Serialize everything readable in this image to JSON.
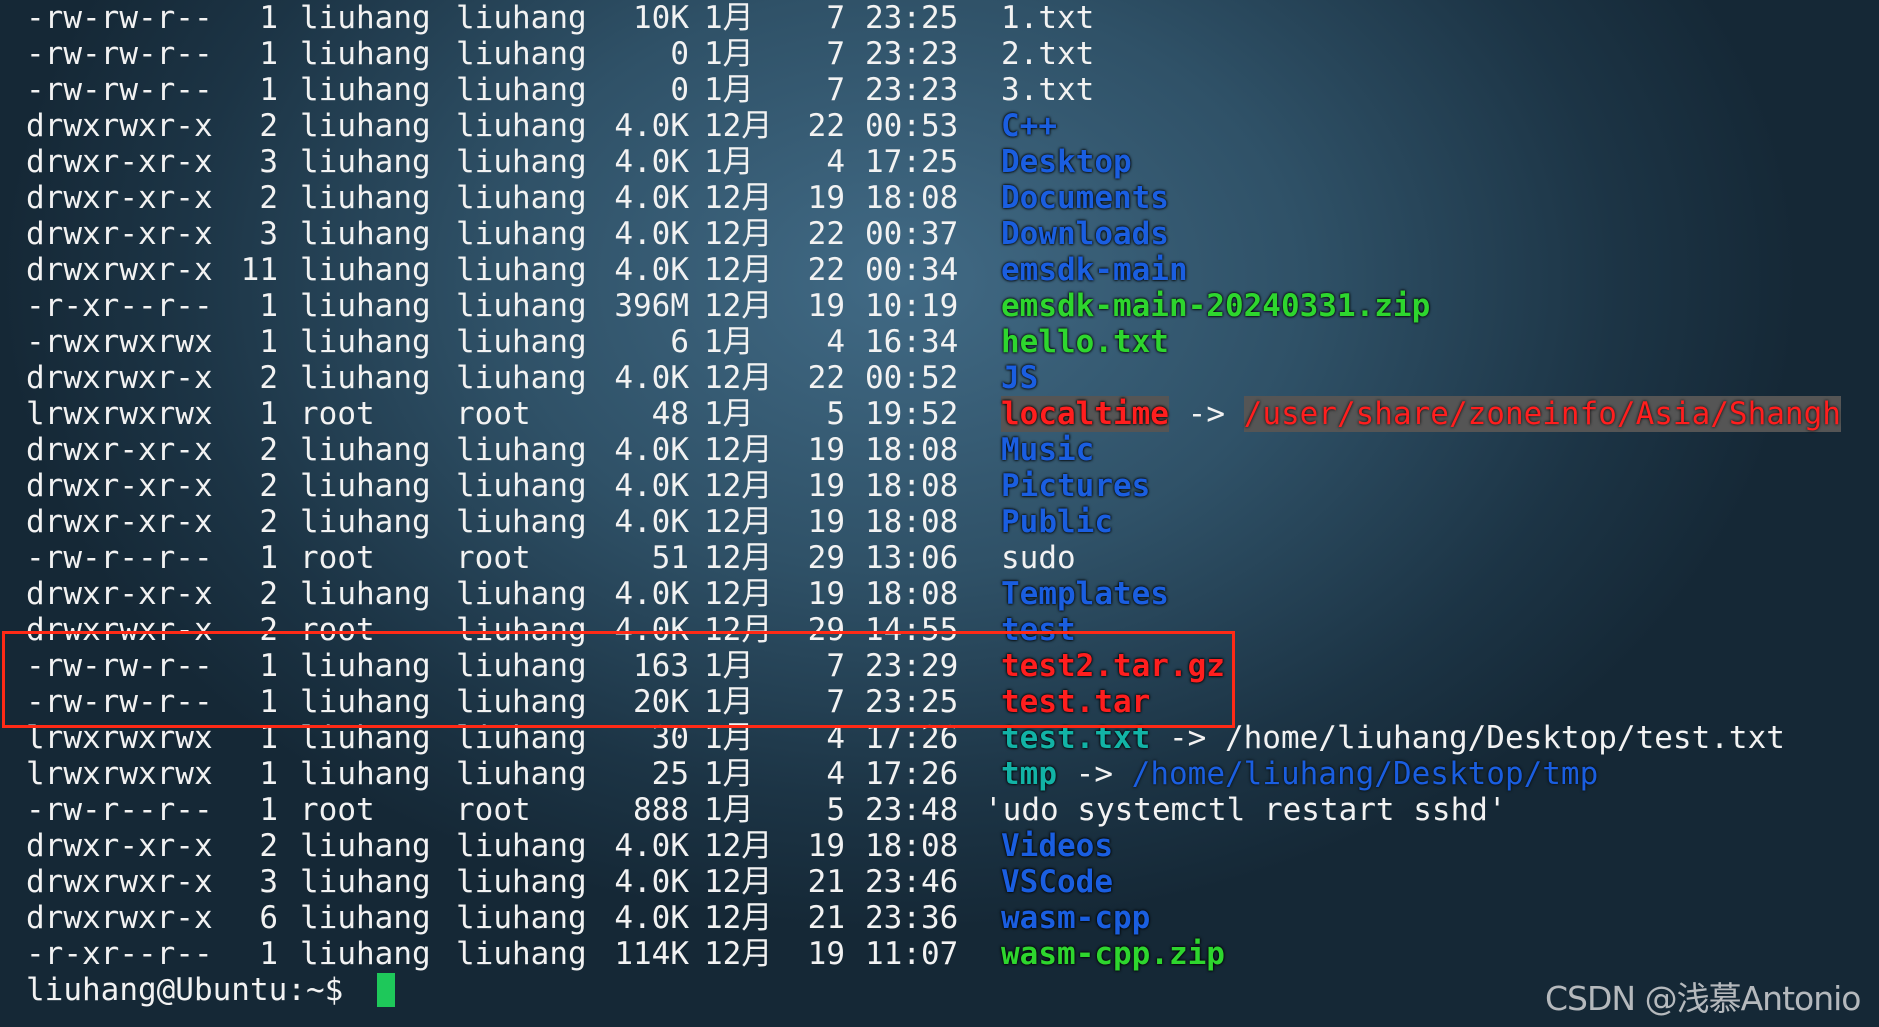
{
  "rows": [
    {
      "perm": "-rw-rw-r--",
      "links": "1",
      "owner": "liuhang",
      "group": "liuhang",
      "size": "10K",
      "month": "1月",
      "day": "7",
      "time": "23:25",
      "name": "1.txt",
      "kind": "plain"
    },
    {
      "perm": "-rw-rw-r--",
      "links": "1",
      "owner": "liuhang",
      "group": "liuhang",
      "size": "0",
      "month": "1月",
      "day": "7",
      "time": "23:23",
      "name": "2.txt",
      "kind": "plain"
    },
    {
      "perm": "-rw-rw-r--",
      "links": "1",
      "owner": "liuhang",
      "group": "liuhang",
      "size": "0",
      "month": "1月",
      "day": "7",
      "time": "23:23",
      "name": "3.txt",
      "kind": "plain"
    },
    {
      "perm": "drwxrwxr-x",
      "links": "2",
      "owner": "liuhang",
      "group": "liuhang",
      "size": "4.0K",
      "month": "12月",
      "day": "22",
      "time": "00:53",
      "name": "C++",
      "kind": "dir"
    },
    {
      "perm": "drwxr-xr-x",
      "links": "3",
      "owner": "liuhang",
      "group": "liuhang",
      "size": "4.0K",
      "month": "1月",
      "day": "4",
      "time": "17:25",
      "name": "Desktop",
      "kind": "dir"
    },
    {
      "perm": "drwxr-xr-x",
      "links": "2",
      "owner": "liuhang",
      "group": "liuhang",
      "size": "4.0K",
      "month": "12月",
      "day": "19",
      "time": "18:08",
      "name": "Documents",
      "kind": "dir"
    },
    {
      "perm": "drwxr-xr-x",
      "links": "3",
      "owner": "liuhang",
      "group": "liuhang",
      "size": "4.0K",
      "month": "12月",
      "day": "22",
      "time": "00:37",
      "name": "Downloads",
      "kind": "dir"
    },
    {
      "perm": "drwxrwxr-x",
      "links": "11",
      "owner": "liuhang",
      "group": "liuhang",
      "size": "4.0K",
      "month": "12月",
      "day": "22",
      "time": "00:34",
      "name": "emsdk-main",
      "kind": "dir"
    },
    {
      "perm": "-r-xr--r--",
      "links": "1",
      "owner": "liuhang",
      "group": "liuhang",
      "size": "396M",
      "month": "12月",
      "day": "19",
      "time": "10:19",
      "name": "emsdk-main-20240331.zip",
      "kind": "zip"
    },
    {
      "perm": "-rwxrwxrwx",
      "links": "1",
      "owner": "liuhang",
      "group": "liuhang",
      "size": "6",
      "month": "1月",
      "day": "4",
      "time": "16:34",
      "name": "hello.txt",
      "kind": "exe"
    },
    {
      "perm": "drwxrwxr-x",
      "links": "2",
      "owner": "liuhang",
      "group": "liuhang",
      "size": "4.0K",
      "month": "12月",
      "day": "22",
      "time": "00:52",
      "name": "JS",
      "kind": "dir"
    },
    {
      "perm": "lrwxrwxrwx",
      "links": "1",
      "owner": "root",
      "group": "root",
      "size": "48",
      "month": "1月",
      "day": "5",
      "time": "19:52",
      "name": "localtime",
      "kind": "broken",
      "target": "/user/share/zoneinfo/Asia/Shangh",
      "target_kind": "broken"
    },
    {
      "perm": "drwxr-xr-x",
      "links": "2",
      "owner": "liuhang",
      "group": "liuhang",
      "size": "4.0K",
      "month": "12月",
      "day": "19",
      "time": "18:08",
      "name": "Music",
      "kind": "dir"
    },
    {
      "perm": "drwxr-xr-x",
      "links": "2",
      "owner": "liuhang",
      "group": "liuhang",
      "size": "4.0K",
      "month": "12月",
      "day": "19",
      "time": "18:08",
      "name": "Pictures",
      "kind": "dir"
    },
    {
      "perm": "drwxr-xr-x",
      "links": "2",
      "owner": "liuhang",
      "group": "liuhang",
      "size": "4.0K",
      "month": "12月",
      "day": "19",
      "time": "18:08",
      "name": "Public",
      "kind": "dir"
    },
    {
      "perm": "-rw-r--r--",
      "links": "1",
      "owner": "root",
      "group": "root",
      "size": "51",
      "month": "12月",
      "day": "29",
      "time": "13:06",
      "name": "sudo",
      "kind": "plain"
    },
    {
      "perm": "drwxr-xr-x",
      "links": "2",
      "owner": "liuhang",
      "group": "liuhang",
      "size": "4.0K",
      "month": "12月",
      "day": "19",
      "time": "18:08",
      "name": "Templates",
      "kind": "dir"
    },
    {
      "perm": "drwxrwxr-x",
      "links": "2",
      "owner": "root",
      "group": "liuhang",
      "size": "4.0K",
      "month": "12月",
      "day": "29",
      "time": "14:55",
      "name": "test",
      "kind": "dir"
    },
    {
      "perm": "-rw-rw-r--",
      "links": "1",
      "owner": "liuhang",
      "group": "liuhang",
      "size": "163",
      "month": "1月",
      "day": "7",
      "time": "23:29",
      "name": "test2.tar.gz",
      "kind": "arch"
    },
    {
      "perm": "-rw-rw-r--",
      "links": "1",
      "owner": "liuhang",
      "group": "liuhang",
      "size": "20K",
      "month": "1月",
      "day": "7",
      "time": "23:25",
      "name": "test.tar",
      "kind": "arch"
    },
    {
      "perm": "lrwxrwxrwx",
      "links": "1",
      "owner": "liuhang",
      "group": "liuhang",
      "size": "30",
      "month": "1月",
      "day": "4",
      "time": "17:26",
      "name": "test.txt",
      "kind": "link",
      "target": "/home/liuhang/Desktop/test.txt",
      "target_kind": "plain"
    },
    {
      "perm": "lrwxrwxrwx",
      "links": "1",
      "owner": "liuhang",
      "group": "liuhang",
      "size": "25",
      "month": "1月",
      "day": "4",
      "time": "17:26",
      "name": "tmp",
      "kind": "link",
      "target": "/home/liuhang/Desktop/tmp",
      "target_kind": "dir"
    },
    {
      "perm": "-rw-r--r--",
      "links": "1",
      "owner": "root",
      "group": "root",
      "size": "888",
      "month": "1月",
      "day": "5",
      "time": "23:48",
      "name": "'udo systemctl restart sshd'",
      "kind": "plain",
      "quoted": true
    },
    {
      "perm": "drwxr-xr-x",
      "links": "2",
      "owner": "liuhang",
      "group": "liuhang",
      "size": "4.0K",
      "month": "12月",
      "day": "19",
      "time": "18:08",
      "name": "Videos",
      "kind": "dir"
    },
    {
      "perm": "drwxrwxr-x",
      "links": "3",
      "owner": "liuhang",
      "group": "liuhang",
      "size": "4.0K",
      "month": "12月",
      "day": "21",
      "time": "23:46",
      "name": "VSCode",
      "kind": "dir"
    },
    {
      "perm": "drwxrwxr-x",
      "links": "6",
      "owner": "liuhang",
      "group": "liuhang",
      "size": "4.0K",
      "month": "12月",
      "day": "21",
      "time": "23:36",
      "name": "wasm-cpp",
      "kind": "dir"
    },
    {
      "perm": "-r-xr--r--",
      "links": "1",
      "owner": "liuhang",
      "group": "liuhang",
      "size": "114K",
      "month": "12月",
      "day": "19",
      "time": "11:07",
      "name": "wasm-cpp.zip",
      "kind": "zip"
    }
  ],
  "arrow": "->",
  "prompt": "liuhang@Ubuntu:~$",
  "watermark": "CSDN @浅慕Antonio",
  "colors": {
    "dir": "#1a5ee0",
    "zip": "#2ed62e",
    "archive": "#ff1e1e",
    "symlink": "#12b3a6",
    "highlight_box": "#ff2a16",
    "cursor": "#1ec85a"
  }
}
